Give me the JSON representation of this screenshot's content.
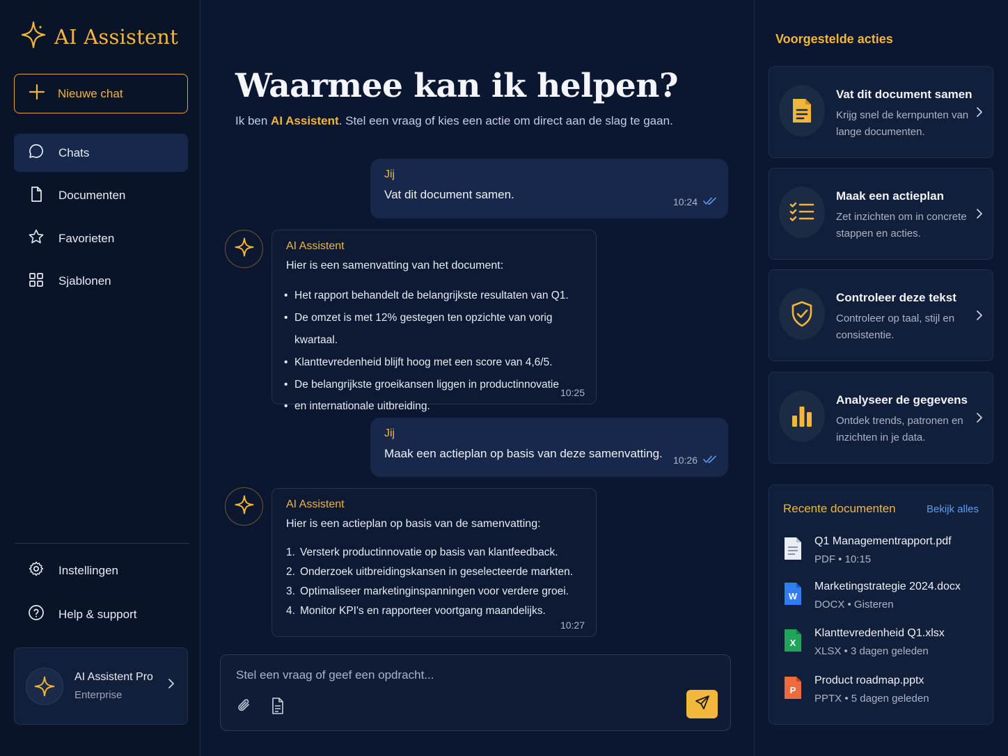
{
  "brand": {
    "title": "AI Assistent",
    "icon": "sparkle-icon"
  },
  "sidebar": {
    "new_chat": "Nieuwe chat",
    "nav": [
      {
        "label": "Chats",
        "icon": "chat-bubble-icon",
        "active": true
      },
      {
        "label": "Documenten",
        "icon": "document-icon"
      },
      {
        "label": "Favorieten",
        "icon": "star-icon"
      },
      {
        "label": "Sjablonen",
        "icon": "grid-icon"
      }
    ],
    "bottom": [
      {
        "label": "Instellingen",
        "icon": "gear-icon"
      },
      {
        "label": "Help & support",
        "icon": "help-circle-icon"
      }
    ],
    "plan": {
      "name": "AI Assistent Pro",
      "tier": "Enterprise"
    }
  },
  "hero": {
    "title": "Waarmee kan ik helpen?",
    "sub_prefix": "Ik ben ",
    "sub_brand": "AI Assistent",
    "sub_suffix": ". Stel een vraag of kies een actie om direct aan de slag te gaan."
  },
  "messages": {
    "m1": {
      "sender": "Jij",
      "text": "Vat dit document samen.",
      "time": "10:24"
    },
    "m2": {
      "sender": "AI Assistent",
      "intro": "Hier is een samenvatting van het document:",
      "items": [
        "Het rapport behandelt de belangrijkste resultaten van Q1.",
        "De omzet is met 12% gestegen ten opzichte van vorig kwartaal.",
        "Klanttevredenheid blijft hoog met een score van 4,6/5.",
        "De belangrijkste groeikansen liggen in productinnovatie",
        "en internationale uitbreiding."
      ],
      "time": "10:25"
    },
    "m3": {
      "sender": "Jij",
      "text": "Maak een actieplan op basis van deze samenvatting.",
      "time": "10:26"
    },
    "m4": {
      "sender": "AI Assistent",
      "intro": "Hier is een actieplan op basis van de samenvatting:",
      "items": [
        {
          "n": "1.",
          "t": "Versterk productinnovatie op basis van klantfeedback."
        },
        {
          "n": "2.",
          "t": "Onderzoek uitbreidingskansen in geselecteerde markten."
        },
        {
          "n": "3.",
          "t": "Optimaliseer marketinginspanningen voor verdere groei."
        },
        {
          "n": "4.",
          "t": "Monitor KPI's en rapporteer voortgang maandelijks."
        }
      ],
      "time": "10:27"
    }
  },
  "composer": {
    "placeholder": "Stel een vraag of geef een opdracht..."
  },
  "right": {
    "title": "Voorgestelde acties",
    "actions": [
      {
        "title": "Vat dit document samen",
        "desc": "Krijg snel de kernpunten van lange documenten.",
        "icon": "document-icon"
      },
      {
        "title": "Maak een actieplan",
        "desc": "Zet inzichten om in concrete stappen en acties.",
        "icon": "checklist-icon"
      },
      {
        "title": "Controleer deze tekst",
        "desc": "Controleer op taal, stijl en consistentie.",
        "icon": "shield-check-icon"
      },
      {
        "title": "Analyseer de gegevens",
        "desc": "Ontdek trends, patronen en inzichten in je data.",
        "icon": "bar-chart-icon"
      }
    ],
    "recent": {
      "title": "Recente documenten",
      "view_all": "Bekijk alles",
      "docs": [
        {
          "name": "Q1 Managementrapport.pdf",
          "meta": "PDF  •  10:15",
          "icon": "pdf-file-icon"
        },
        {
          "name": "Marketingstrategie 2024.docx",
          "meta": "DOCX  •  Gisteren",
          "icon": "word-file-icon"
        },
        {
          "name": "Klanttevredenheid Q1.xlsx",
          "meta": "XLSX  •  3 dagen geleden",
          "icon": "excel-file-icon"
        },
        {
          "name": "Product roadmap.pptx",
          "meta": "PPTX  •  5 dagen geleden",
          "icon": "powerpoint-file-icon"
        }
      ]
    }
  },
  "colors": {
    "accent": "#f2b63a",
    "background": "#0b1630",
    "panel": "#121f3b",
    "link": "#5b9df2"
  }
}
